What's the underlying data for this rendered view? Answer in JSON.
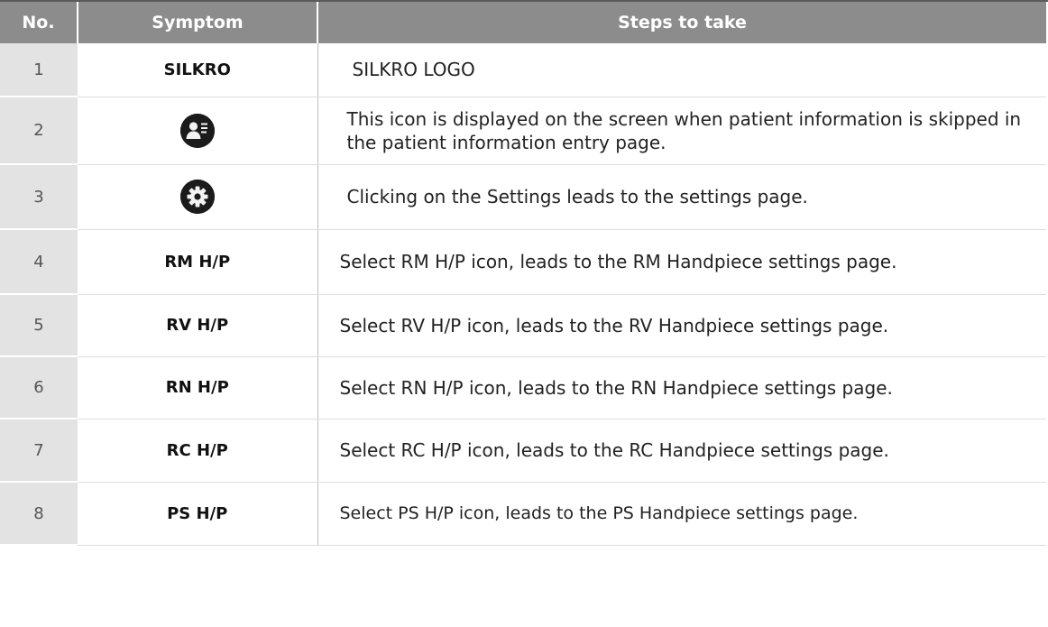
{
  "table": {
    "headers": [
      "No.",
      "Symptom",
      "Steps to take"
    ],
    "rows": [
      {
        "no": "1",
        "symptom": "SILKRO",
        "steps": "SILKRO LOGO"
      },
      {
        "no": "2",
        "symptom_icon": "patient-info-icon",
        "steps": "This icon is displayed on the screen when patient information is skipped in the patient information entry page."
      },
      {
        "no": "3",
        "symptom_icon": "settings-gear-icon",
        "steps": "Clicking on the Settings leads to the settings page."
      },
      {
        "no": "4",
        "symptom": "RM H/P",
        "steps": "Select RM H/P icon, leads to the RM Handpiece settings page."
      },
      {
        "no": "5",
        "symptom": "RV H/P",
        "steps": "Select RV H/P icon, leads to the RV Handpiece settings page."
      },
      {
        "no": "6",
        "symptom": "RN H/P",
        "steps": "Select RN H/P icon, leads to the RN Handpiece settings page."
      },
      {
        "no": "7",
        "symptom": "RC H/P",
        "steps": "Select RC H/P icon, leads to the RC Handpiece settings page."
      },
      {
        "no": "8",
        "symptom": "PS H/P",
        "steps": "Select PS H/P icon, leads to the PS Handpiece settings page."
      }
    ]
  }
}
